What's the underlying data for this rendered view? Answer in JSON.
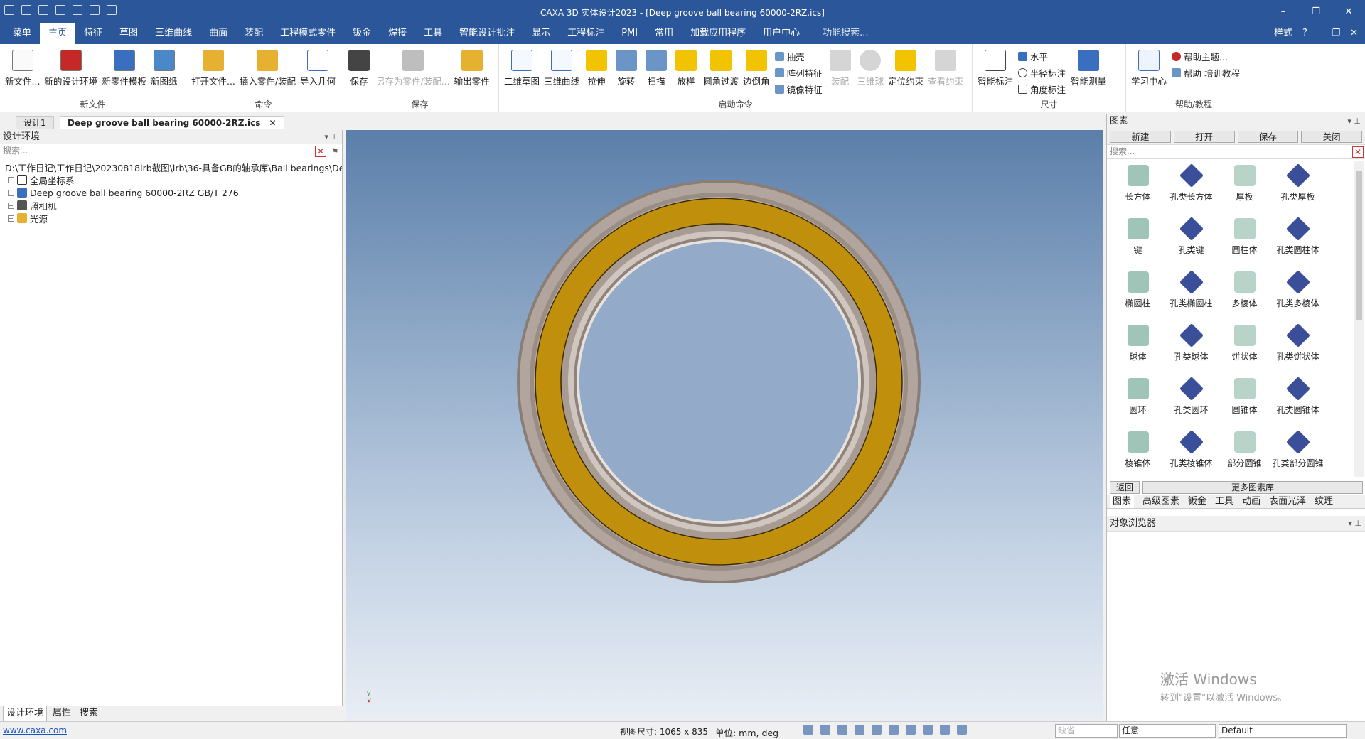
{
  "window": {
    "title": "CAXA 3D 实体设计2023 - [Deep groove ball bearing 60000-2RZ.ics]"
  },
  "menu": {
    "tabs": [
      "菜单",
      "主页",
      "特征",
      "草图",
      "三维曲线",
      "曲面",
      "装配",
      "工程模式零件",
      "钣金",
      "焊接",
      "工具",
      "智能设计批注",
      "显示",
      "工程标注",
      "PMI",
      "常用",
      "加载应用程序",
      "用户中心"
    ],
    "active": "主页",
    "search_placeholder": "功能搜索...",
    "style_label": "样式"
  },
  "ribbon": {
    "new_file": {
      "label": "新文件",
      "items": [
        "新文件...",
        "新的设计环境",
        "新零件模板",
        "新图纸"
      ]
    },
    "command": {
      "label": "命令",
      "items": [
        "打开文件...",
        "插入零件/装配",
        "导入几何"
      ]
    },
    "save": {
      "label": "保存",
      "items": [
        "保存",
        "另存为零件/装配...",
        "输出零件"
      ]
    },
    "start": {
      "label": "启动命令",
      "items": [
        "二维草图",
        "三维曲线",
        "拉伸",
        "旋转",
        "扫描",
        "放样",
        "圆角过渡",
        "边倒角"
      ],
      "small": [
        "抽壳",
        "阵列特征",
        "镜像特征"
      ],
      "disabled": [
        "装配",
        "三维球",
        "定位约束",
        "查看约束"
      ]
    },
    "dim": {
      "label": "尺寸",
      "items": [
        "智能标注"
      ],
      "small": [
        "水平",
        "半径标注",
        "角度标注"
      ],
      "measure": "智能测量"
    },
    "help": {
      "label": "帮助/教程",
      "items": [
        "学习中心"
      ],
      "small": [
        "帮助主题...",
        "帮助 培训教程"
      ]
    }
  },
  "doc_tabs": [
    "设计1",
    "Deep groove ball bearing 60000-2RZ.ics"
  ],
  "left": {
    "title": "设计环境",
    "search_placeholder": "搜索...",
    "path": "D:\\工作日记\\工作日记\\20230818lrb截图\\lrb\\36-具备GB的轴承库\\Ball bearings\\De",
    "tree": [
      "全局坐标系",
      "Deep groove ball bearing 60000-2RZ GB/T 276",
      "照相机",
      "光源"
    ],
    "tabs": [
      "设计环境",
      "属性",
      "搜索"
    ]
  },
  "right": {
    "title": "图素",
    "toolbar": [
      "新建",
      "打开",
      "保存",
      "关闭"
    ],
    "search_placeholder": "搜索...",
    "shapes": [
      "长方体",
      "孔类长方体",
      "厚板",
      "孔类厚板",
      "键",
      "孔类键",
      "圆柱体",
      "孔类圆柱体",
      "椭圆柱",
      "孔类椭圆柱",
      "多棱体",
      "孔类多棱体",
      "球体",
      "孔类球体",
      "饼状体",
      "孔类饼状体",
      "圆环",
      "孔类圆环",
      "圆锥体",
      "孔类圆锥体",
      "棱锥体",
      "孔类棱锥体",
      "部分圆锥",
      "孔类部分圆锥"
    ],
    "nav": [
      "返回",
      "更多图素库"
    ],
    "tabs": [
      "图素",
      "高级图素",
      "钣金",
      "工具",
      "动画",
      "表面光泽",
      "纹理"
    ],
    "object_browser": "对象浏览器",
    "watermark": [
      "激活 Windows",
      "转到\"设置\"以激活 Windows。"
    ]
  },
  "status": {
    "link": "www.caxa.com",
    "view_size": "视图尺寸: 1065 x 835",
    "unit": "单位:   mm, deg",
    "selects": [
      "缺省",
      "任意",
      "Default"
    ]
  },
  "colors": {
    "accent": "#2b579a",
    "bearing_outer": "#a89b93",
    "bearing_seal": "#b88a0a"
  }
}
